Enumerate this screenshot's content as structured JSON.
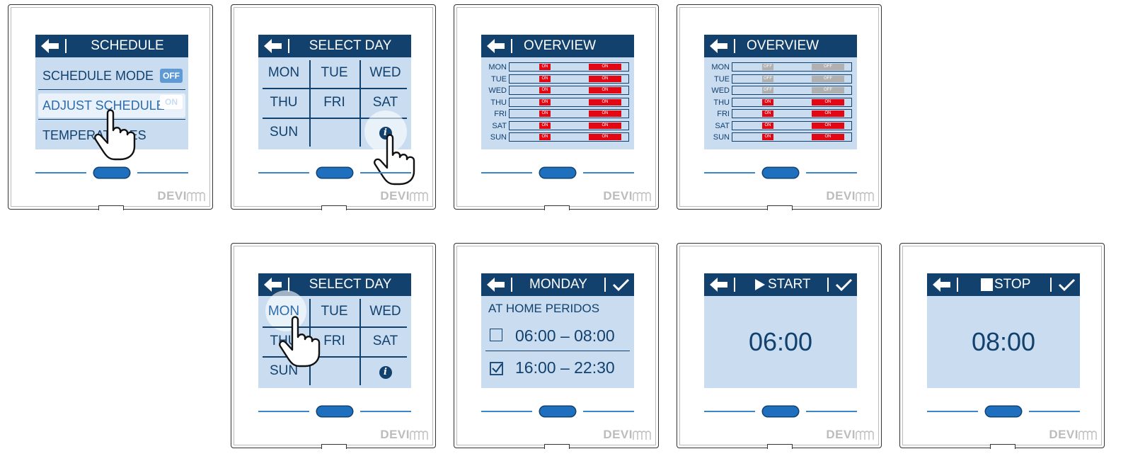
{
  "brand": "DEVI",
  "colors": {
    "header": "#12416e",
    "screen": "#c9dcf0",
    "on": "#e30613",
    "off": "#b0b0b0",
    "toggle_off": "#5d9ad6",
    "toggle_on": "#e9f1fa"
  },
  "panel1": {
    "title": "SCHEDULE",
    "rows": [
      {
        "label": "SCHEDULE MODE",
        "toggle": "OFF"
      },
      {
        "label": "ADJUST SCHEDULE",
        "toggle": "ON"
      },
      {
        "label": "TEMPERATURES"
      }
    ]
  },
  "panel2": {
    "title": "SELECT DAY",
    "days": [
      "MON",
      "TUE",
      "WED",
      "THU",
      "FRI",
      "SAT",
      "SUN"
    ],
    "info": "i"
  },
  "panel3": {
    "title": "OVERVIEW",
    "rows": [
      {
        "day": "MON",
        "seg1": "ON",
        "seg2": "ON"
      },
      {
        "day": "TUE",
        "seg1": "ON",
        "seg2": "ON"
      },
      {
        "day": "WED",
        "seg1": "ON",
        "seg2": "ON"
      },
      {
        "day": "THU",
        "seg1": "ON",
        "seg2": "ON"
      },
      {
        "day": "FRI",
        "seg1": "ON",
        "seg2": "ON"
      },
      {
        "day": "SAT",
        "seg1": "ON",
        "seg2": "ON"
      },
      {
        "day": "SUN",
        "seg1": "ON",
        "seg2": "ON"
      }
    ]
  },
  "panel4": {
    "title": "OVERVIEW",
    "rows": [
      {
        "day": "MON",
        "seg1": "OFF",
        "seg2": "OFF"
      },
      {
        "day": "TUE",
        "seg1": "OFF",
        "seg2": "OFF"
      },
      {
        "day": "WED",
        "seg1": "OFF",
        "seg2": "OFF"
      },
      {
        "day": "THU",
        "seg1": "ON",
        "seg2": "ON"
      },
      {
        "day": "FRI",
        "seg1": "ON",
        "seg2": "ON"
      },
      {
        "day": "SAT",
        "seg1": "ON",
        "seg2": "ON"
      },
      {
        "day": "SUN",
        "seg1": "ON",
        "seg2": "ON"
      }
    ]
  },
  "panel5": {
    "title": "SELECT DAY",
    "days": [
      "MON",
      "TUE",
      "WED",
      "THU",
      "FRI",
      "SAT",
      "SUN"
    ],
    "info": "i"
  },
  "panel6": {
    "title": "MONDAY",
    "subtitle": "AT HOME PERIDOS",
    "periods": [
      {
        "time": "06:00 – 08:00",
        "checked": false
      },
      {
        "time": "16:00 – 22:30",
        "checked": true
      }
    ]
  },
  "panel7": {
    "title": "START",
    "time": "06:00"
  },
  "panel8": {
    "title": "STOP",
    "time": "08:00"
  }
}
